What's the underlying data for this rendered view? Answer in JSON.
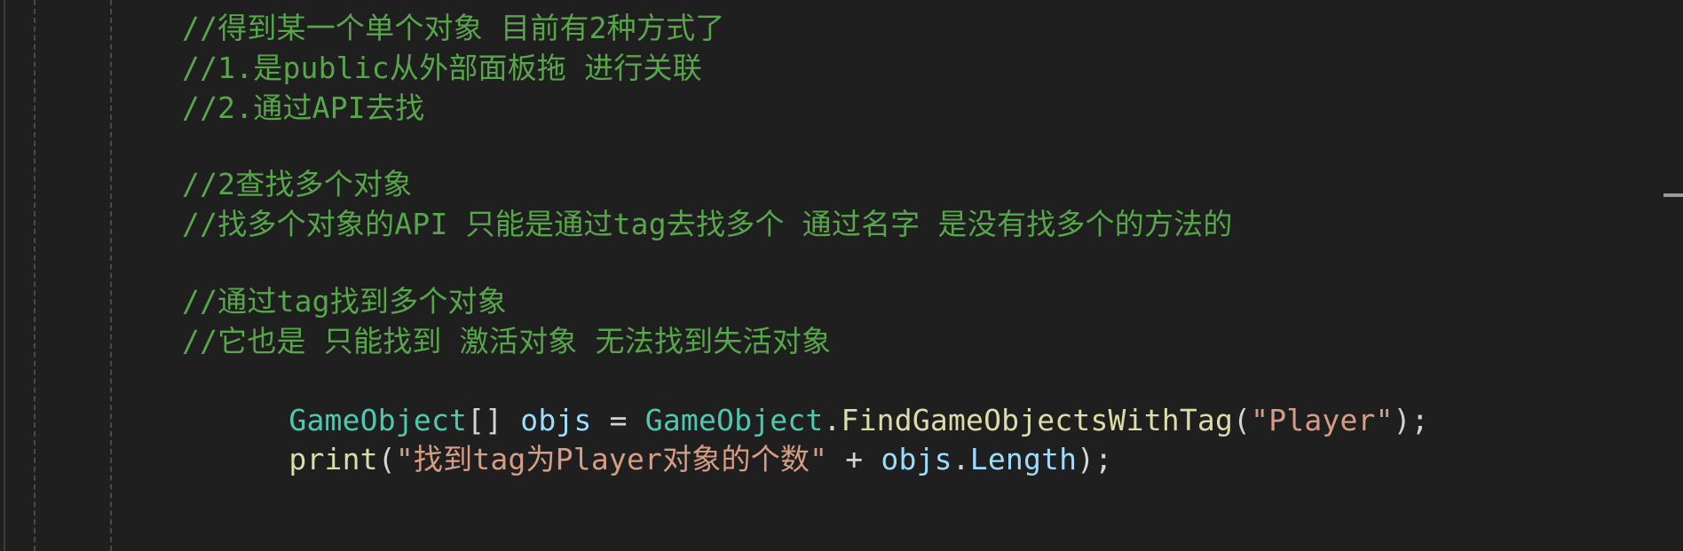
{
  "code_lines": {
    "l1": "//得到某一个单个对象 目前有2种方式了",
    "l2": "//1.是public从外部面板拖 进行关联",
    "l3": "//2.通过API去找",
    "l4": "//2查找多个对象",
    "l5": "//找多个对象的API 只能是通过tag去找多个 通过名字 是没有找多个的方法的",
    "l6": "//通过tag找到多个对象",
    "l7": "//它也是 只能找到 激活对象 无法找到失活对象",
    "l8": {
      "t1": "GameObject",
      "p1": "[] ",
      "t2": "objs",
      "p2": " = ",
      "t3": "GameObject",
      "p3": ".",
      "t4": "FindGameObjectsWithTag",
      "p4": "(",
      "t5": "\"Player\"",
      "p5": ");"
    },
    "l9": {
      "t1": "print",
      "p1": "(",
      "t2": "\"找到tag为Player对象的个数\"",
      "p2": " + ",
      "t3": "objs",
      "p3": ".",
      "t4": "Length",
      "p4": ");"
    }
  },
  "colors": {
    "background": "#1f1f1f",
    "comment": "#57a64a",
    "type": "#4ec9b0",
    "identifier": "#9cdcfe",
    "method": "#dcdcaa",
    "string": "#d69d85",
    "punctuation": "#d4d4d4"
  }
}
